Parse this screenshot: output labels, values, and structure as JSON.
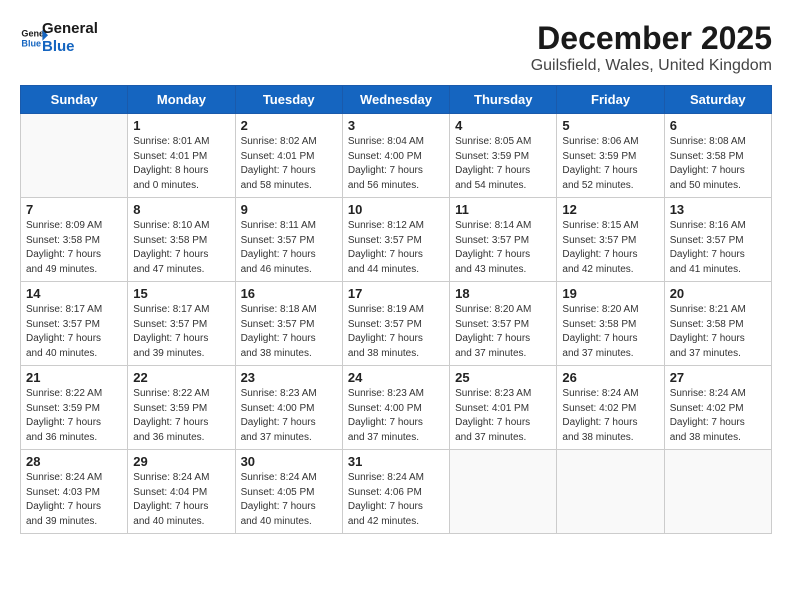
{
  "logo": {
    "line1": "General",
    "line2": "Blue"
  },
  "title": "December 2025",
  "subtitle": "Guilsfield, Wales, United Kingdom",
  "weekdays": [
    "Sunday",
    "Monday",
    "Tuesday",
    "Wednesday",
    "Thursday",
    "Friday",
    "Saturday"
  ],
  "weeks": [
    [
      {
        "day": "",
        "info": ""
      },
      {
        "day": "1",
        "info": "Sunrise: 8:01 AM\nSunset: 4:01 PM\nDaylight: 8 hours\nand 0 minutes."
      },
      {
        "day": "2",
        "info": "Sunrise: 8:02 AM\nSunset: 4:01 PM\nDaylight: 7 hours\nand 58 minutes."
      },
      {
        "day": "3",
        "info": "Sunrise: 8:04 AM\nSunset: 4:00 PM\nDaylight: 7 hours\nand 56 minutes."
      },
      {
        "day": "4",
        "info": "Sunrise: 8:05 AM\nSunset: 3:59 PM\nDaylight: 7 hours\nand 54 minutes."
      },
      {
        "day": "5",
        "info": "Sunrise: 8:06 AM\nSunset: 3:59 PM\nDaylight: 7 hours\nand 52 minutes."
      },
      {
        "day": "6",
        "info": "Sunrise: 8:08 AM\nSunset: 3:58 PM\nDaylight: 7 hours\nand 50 minutes."
      }
    ],
    [
      {
        "day": "7",
        "info": "Sunrise: 8:09 AM\nSunset: 3:58 PM\nDaylight: 7 hours\nand 49 minutes."
      },
      {
        "day": "8",
        "info": "Sunrise: 8:10 AM\nSunset: 3:58 PM\nDaylight: 7 hours\nand 47 minutes."
      },
      {
        "day": "9",
        "info": "Sunrise: 8:11 AM\nSunset: 3:57 PM\nDaylight: 7 hours\nand 46 minutes."
      },
      {
        "day": "10",
        "info": "Sunrise: 8:12 AM\nSunset: 3:57 PM\nDaylight: 7 hours\nand 44 minutes."
      },
      {
        "day": "11",
        "info": "Sunrise: 8:14 AM\nSunset: 3:57 PM\nDaylight: 7 hours\nand 43 minutes."
      },
      {
        "day": "12",
        "info": "Sunrise: 8:15 AM\nSunset: 3:57 PM\nDaylight: 7 hours\nand 42 minutes."
      },
      {
        "day": "13",
        "info": "Sunrise: 8:16 AM\nSunset: 3:57 PM\nDaylight: 7 hours\nand 41 minutes."
      }
    ],
    [
      {
        "day": "14",
        "info": "Sunrise: 8:17 AM\nSunset: 3:57 PM\nDaylight: 7 hours\nand 40 minutes."
      },
      {
        "day": "15",
        "info": "Sunrise: 8:17 AM\nSunset: 3:57 PM\nDaylight: 7 hours\nand 39 minutes."
      },
      {
        "day": "16",
        "info": "Sunrise: 8:18 AM\nSunset: 3:57 PM\nDaylight: 7 hours\nand 38 minutes."
      },
      {
        "day": "17",
        "info": "Sunrise: 8:19 AM\nSunset: 3:57 PM\nDaylight: 7 hours\nand 38 minutes."
      },
      {
        "day": "18",
        "info": "Sunrise: 8:20 AM\nSunset: 3:57 PM\nDaylight: 7 hours\nand 37 minutes."
      },
      {
        "day": "19",
        "info": "Sunrise: 8:20 AM\nSunset: 3:58 PM\nDaylight: 7 hours\nand 37 minutes."
      },
      {
        "day": "20",
        "info": "Sunrise: 8:21 AM\nSunset: 3:58 PM\nDaylight: 7 hours\nand 37 minutes."
      }
    ],
    [
      {
        "day": "21",
        "info": "Sunrise: 8:22 AM\nSunset: 3:59 PM\nDaylight: 7 hours\nand 36 minutes."
      },
      {
        "day": "22",
        "info": "Sunrise: 8:22 AM\nSunset: 3:59 PM\nDaylight: 7 hours\nand 36 minutes."
      },
      {
        "day": "23",
        "info": "Sunrise: 8:23 AM\nSunset: 4:00 PM\nDaylight: 7 hours\nand 37 minutes."
      },
      {
        "day": "24",
        "info": "Sunrise: 8:23 AM\nSunset: 4:00 PM\nDaylight: 7 hours\nand 37 minutes."
      },
      {
        "day": "25",
        "info": "Sunrise: 8:23 AM\nSunset: 4:01 PM\nDaylight: 7 hours\nand 37 minutes."
      },
      {
        "day": "26",
        "info": "Sunrise: 8:24 AM\nSunset: 4:02 PM\nDaylight: 7 hours\nand 38 minutes."
      },
      {
        "day": "27",
        "info": "Sunrise: 8:24 AM\nSunset: 4:02 PM\nDaylight: 7 hours\nand 38 minutes."
      }
    ],
    [
      {
        "day": "28",
        "info": "Sunrise: 8:24 AM\nSunset: 4:03 PM\nDaylight: 7 hours\nand 39 minutes."
      },
      {
        "day": "29",
        "info": "Sunrise: 8:24 AM\nSunset: 4:04 PM\nDaylight: 7 hours\nand 40 minutes."
      },
      {
        "day": "30",
        "info": "Sunrise: 8:24 AM\nSunset: 4:05 PM\nDaylight: 7 hours\nand 40 minutes."
      },
      {
        "day": "31",
        "info": "Sunrise: 8:24 AM\nSunset: 4:06 PM\nDaylight: 7 hours\nand 42 minutes."
      },
      {
        "day": "",
        "info": ""
      },
      {
        "day": "",
        "info": ""
      },
      {
        "day": "",
        "info": ""
      }
    ]
  ]
}
